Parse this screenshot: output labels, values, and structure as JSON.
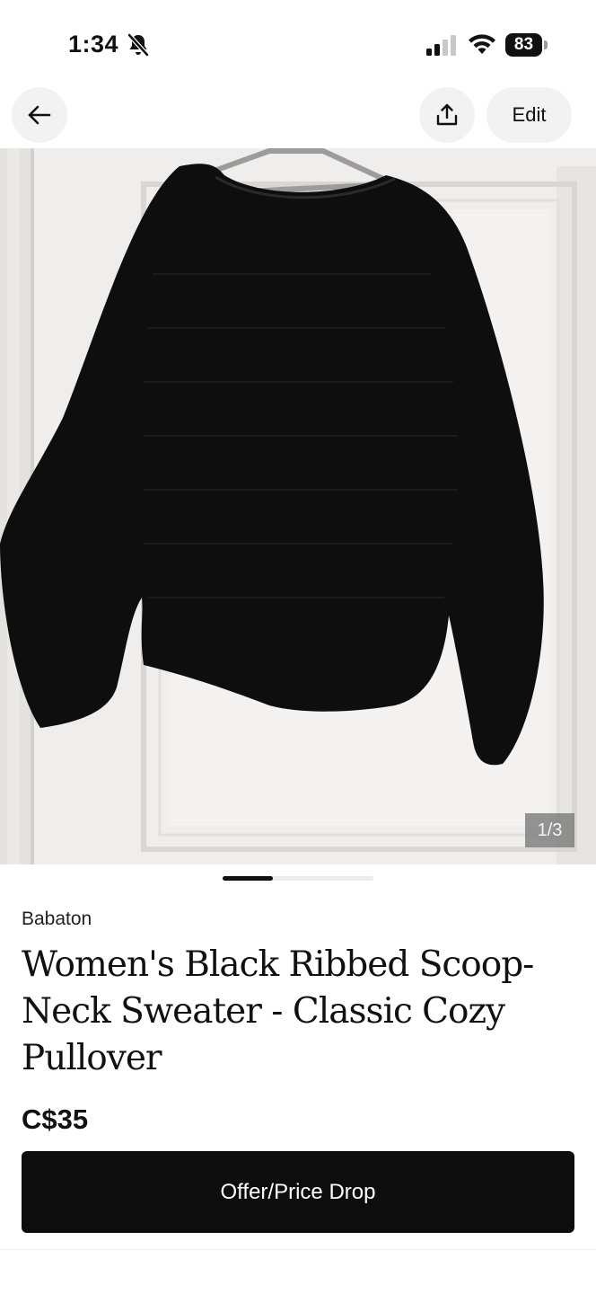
{
  "status_bar": {
    "time": "1:34",
    "battery_level": "83",
    "icons": [
      "bell-slash-icon",
      "cellular-signal-icon",
      "wifi-icon",
      "battery-icon"
    ]
  },
  "nav": {
    "back_icon": "arrow-left-icon",
    "share_icon": "share-upload-icon",
    "edit_label": "Edit"
  },
  "gallery": {
    "counter": "1/3",
    "current_index": 1,
    "total": 3
  },
  "listing": {
    "brand": "Babaton",
    "title": "Women's Black Ribbed Scoop-Neck Sweater - Classic Cozy Pullover",
    "price": "C$35",
    "offer_button_label": "Offer/Price Drop"
  },
  "colors": {
    "button_bg": "#0d0d0d",
    "chip_bg": "#f2f2f2",
    "text": "#111111"
  }
}
